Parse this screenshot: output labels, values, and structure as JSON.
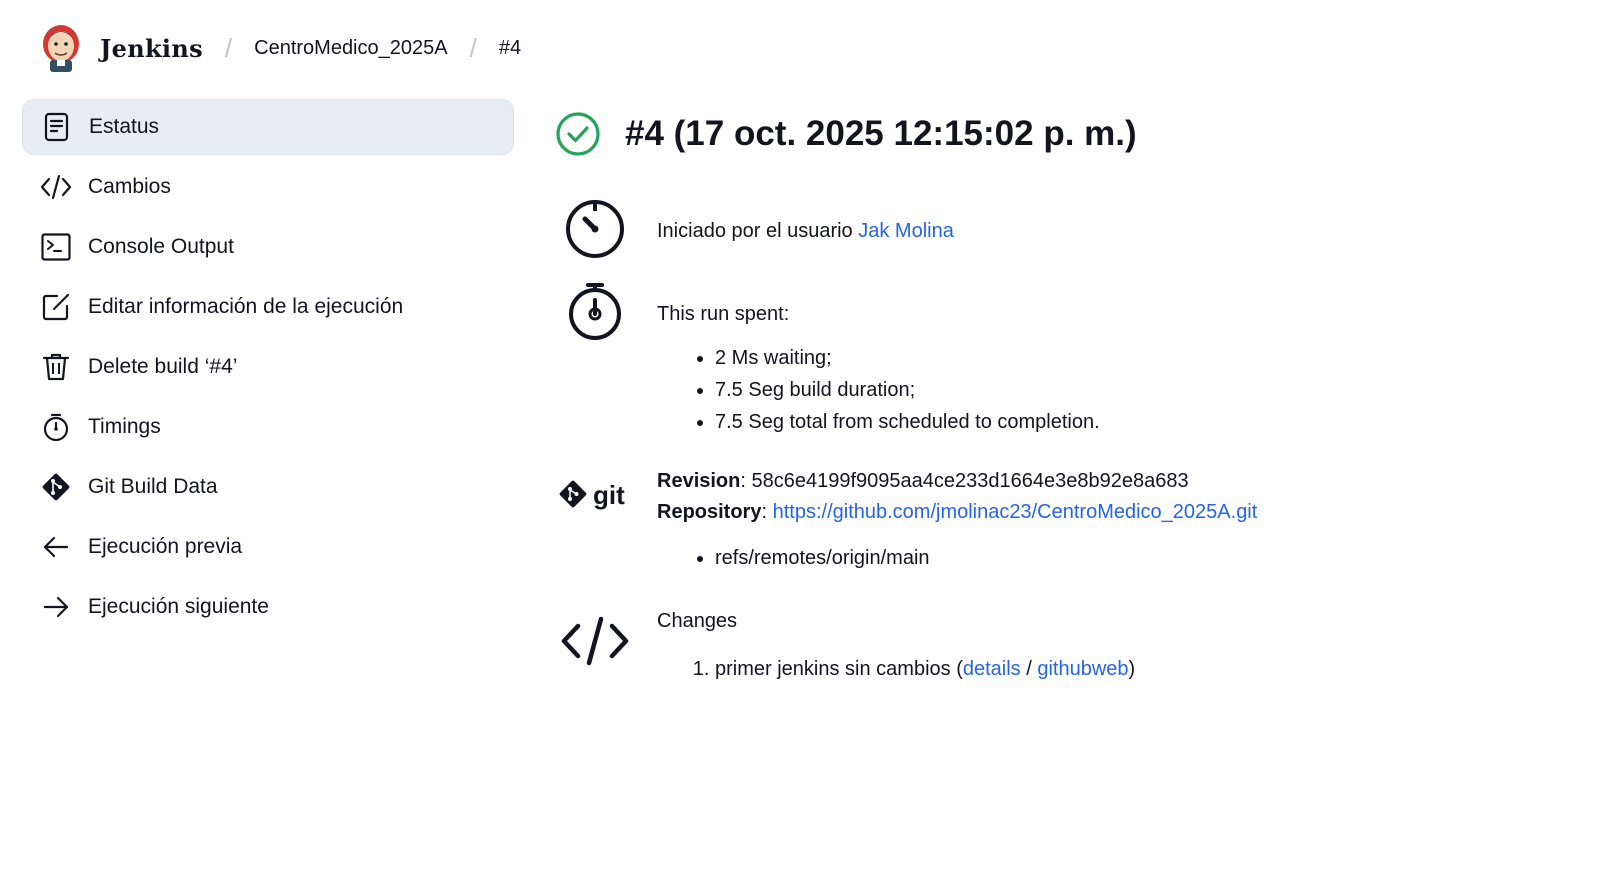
{
  "header": {
    "brand": "Jenkins",
    "breadcrumbs": [
      "CentroMedico_2025A",
      "#4"
    ]
  },
  "sidebar": {
    "items": [
      {
        "label": "Estatus",
        "icon": "document-icon",
        "active": true
      },
      {
        "label": "Cambios",
        "icon": "code-icon"
      },
      {
        "label": "Console Output",
        "icon": "terminal-icon"
      },
      {
        "label": "Editar información de la ejecución",
        "icon": "edit-icon"
      },
      {
        "label": "Delete build ‘#4’",
        "icon": "trash-icon"
      },
      {
        "label": "Timings",
        "icon": "stopwatch-icon"
      },
      {
        "label": "Git Build Data",
        "icon": "git-icon"
      },
      {
        "label": "Ejecución previa",
        "icon": "arrow-left-icon"
      },
      {
        "label": "Ejecución siguiente",
        "icon": "arrow-right-icon"
      }
    ]
  },
  "main": {
    "title": "#4 (17 oct. 2025 12:15:02 p. m.)",
    "status_color": "#22a559",
    "started_by_prefix": "Iniciado por el usuario ",
    "started_by_user": "Jak Molina",
    "run_spent_label": "This run spent:",
    "run_spent_items": [
      "2 Ms waiting;",
      "7.5 Seg build duration;",
      "7.5 Seg total from scheduled to completion."
    ],
    "git": {
      "logo_text": "git",
      "revision_label": "Revision",
      "revision_value": "58c6e4199f9095aa4ce233d1664e3e8b92e8a683",
      "repository_label": "Repository",
      "repository_url": "https://github.com/jmolinac23/CentroMedico_2025A.git",
      "branches": [
        "refs/remotes/origin/main"
      ]
    },
    "changes": {
      "label": "Changes",
      "items": [
        {
          "message": "primer jenkins sin cambios",
          "details_label": "details",
          "web_label": "githubweb"
        }
      ]
    }
  }
}
